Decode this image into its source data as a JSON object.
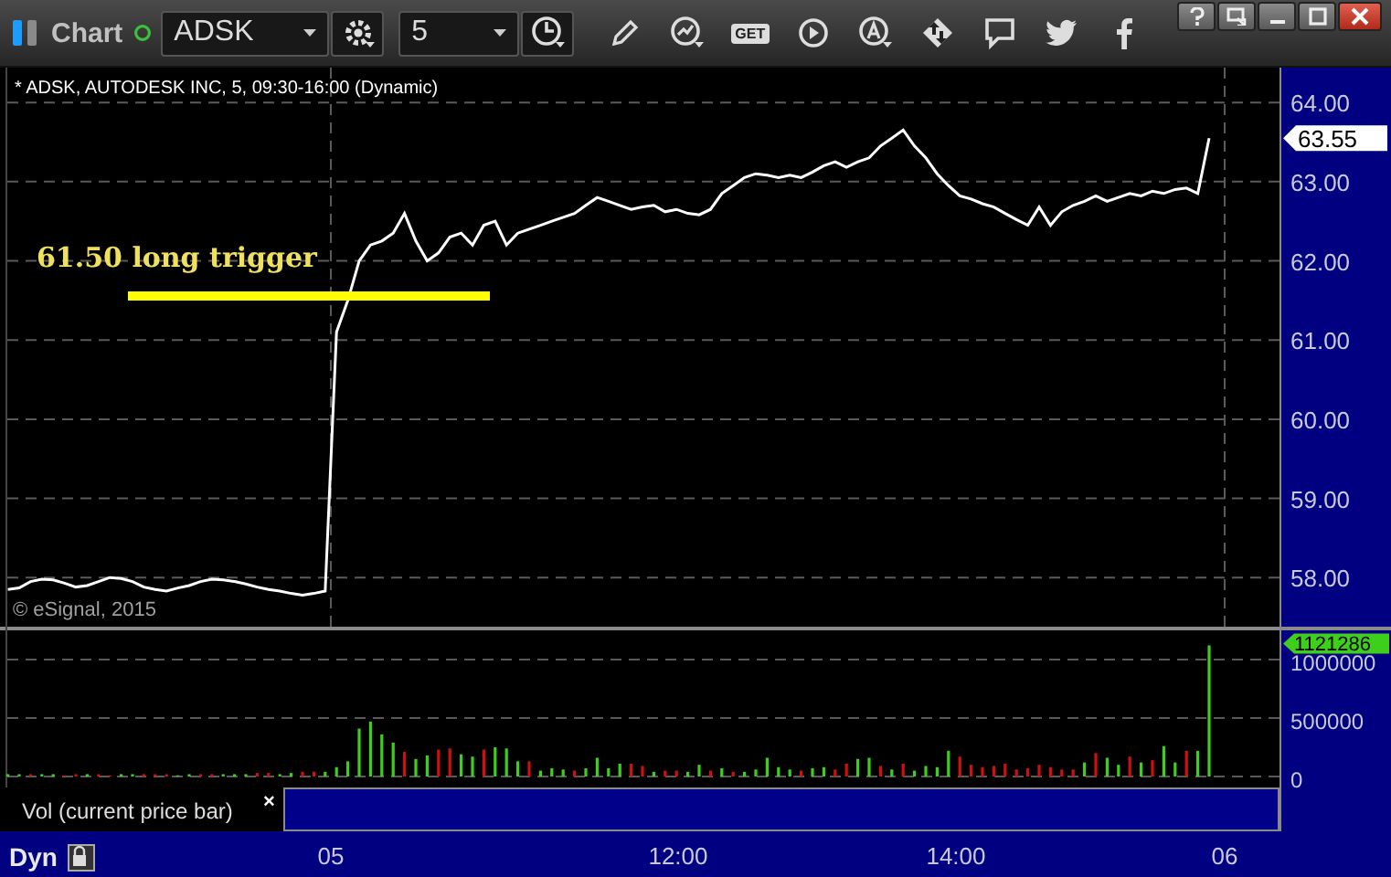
{
  "toolbar": {
    "title": "Chart",
    "symbol": "ADSK",
    "interval": "5",
    "get_label": "GET"
  },
  "price_panel": {
    "copyright": "© eSignal, 2015",
    "last_value_label": "63.55",
    "chart_data": {
      "type": "line",
      "title": "* ADSK, AUTODESK INC, 5, 09:30-16:00 (Dynamic)",
      "ylim": [
        57.38,
        64.44
      ],
      "grid": true,
      "yticks": [
        {
          "value": 58,
          "label": "58.00"
        },
        {
          "value": 59,
          "label": "59.00"
        },
        {
          "value": 60,
          "label": "60.00"
        },
        {
          "value": 61,
          "label": "61.00"
        },
        {
          "value": 62,
          "label": "62.00"
        },
        {
          "value": 63,
          "label": "63.00"
        },
        {
          "value": 64,
          "label": "64.00"
        }
      ],
      "series": [
        {
          "color": "#ffffff",
          "values": [
            57.85,
            57.87,
            57.95,
            57.98,
            57.97,
            57.93,
            57.88,
            57.9,
            57.95,
            58.0,
            57.99,
            57.95,
            57.88,
            57.85,
            57.83,
            57.87,
            57.9,
            57.95,
            57.98,
            57.97,
            57.95,
            57.92,
            57.88,
            57.85,
            57.83,
            57.8,
            57.78,
            57.8,
            57.83,
            61.1,
            61.5,
            62.0,
            62.2,
            62.25,
            62.35,
            62.6,
            62.25,
            62.0,
            62.1,
            62.3,
            62.35,
            62.2,
            62.45,
            62.5,
            62.2,
            62.35,
            62.4,
            62.45,
            62.5,
            62.55,
            62.6,
            62.7,
            62.8,
            62.75,
            62.7,
            62.65,
            62.68,
            62.7,
            62.62,
            62.65,
            62.6,
            62.58,
            62.65,
            62.85,
            62.95,
            63.05,
            63.1,
            63.08,
            63.05,
            63.08,
            63.05,
            63.12,
            63.2,
            63.25,
            63.18,
            63.25,
            63.3,
            63.45,
            63.55,
            63.65,
            63.45,
            63.3,
            63.1,
            62.95,
            62.82,
            62.78,
            62.72,
            62.68,
            62.6,
            62.52,
            62.45,
            62.68,
            62.45,
            62.62,
            62.7,
            62.75,
            62.82,
            62.75,
            62.8,
            62.85,
            62.82,
            62.88,
            62.85,
            62.9,
            62.92,
            62.85,
            63.55
          ]
        }
      ],
      "annotations": [
        "61.50 long trigger"
      ]
    }
  },
  "volume_panel": {
    "legend": "Vol (current price bar)",
    "legend_close": "×",
    "last_value_label": "1121286",
    "chart_data": {
      "type": "bar",
      "ylim": [
        0,
        1250000
      ],
      "grid": true,
      "yticks": [
        {
          "value": 0,
          "label": "0"
        },
        {
          "value": 500000,
          "label": "500000"
        },
        {
          "value": 1000000,
          "label": "1000000"
        }
      ],
      "series": [
        {
          "color": "#3ecf1c",
          "values": [
            20000,
            20000,
            null,
            20000,
            20000,
            null,
            null,
            20000,
            null,
            null,
            20000,
            20000,
            null,
            null,
            null,
            10000,
            20000,
            null,
            null,
            20000,
            20000,
            20000,
            null,
            null,
            20000,
            30000,
            null,
            null,
            40000,
            80000,
            130000,
            410000,
            470000,
            360000,
            290000,
            null,
            150000,
            180000,
            null,
            null,
            190000,
            170000,
            null,
            250000,
            240000,
            130000,
            null,
            50000,
            70000,
            60000,
            null,
            70000,
            160000,
            70000,
            110000,
            null,
            null,
            40000,
            null,
            null,
            40000,
            100000,
            null,
            70000,
            null,
            40000,
            60000,
            160000,
            80000,
            60000,
            null,
            70000,
            80000,
            null,
            null,
            150000,
            160000,
            null,
            60000,
            null,
            50000,
            90000,
            80000,
            220000,
            null,
            null,
            null,
            null,
            null,
            null,
            null,
            null,
            null,
            null,
            null,
            120000,
            null,
            160000,
            100000,
            null,
            120000,
            null,
            260000,
            120000,
            null,
            220000,
            1121286
          ]
        },
        {
          "color": "#d01010",
          "values": [
            null,
            null,
            20000,
            null,
            null,
            10000,
            20000,
            null,
            20000,
            10000,
            null,
            null,
            20000,
            20000,
            20000,
            null,
            null,
            20000,
            20000,
            null,
            null,
            null,
            30000,
            30000,
            null,
            null,
            40000,
            40000,
            null,
            null,
            null,
            null,
            null,
            null,
            null,
            210000,
            null,
            null,
            230000,
            240000,
            null,
            null,
            230000,
            null,
            null,
            null,
            130000,
            null,
            null,
            null,
            50000,
            null,
            null,
            null,
            null,
            110000,
            90000,
            null,
            50000,
            50000,
            null,
            null,
            50000,
            null,
            40000,
            null,
            null,
            null,
            null,
            null,
            50000,
            null,
            null,
            60000,
            110000,
            null,
            null,
            90000,
            null,
            110000,
            null,
            null,
            null,
            null,
            170000,
            100000,
            80000,
            90000,
            110000,
            60000,
            70000,
            100000,
            80000,
            60000,
            60000,
            null,
            200000,
            null,
            null,
            170000,
            null,
            140000,
            null,
            null,
            220000,
            null,
            null
          ]
        }
      ]
    }
  },
  "time_axis": {
    "mode": "Dyn",
    "labels": [
      "05",
      "12:00",
      "14:00",
      "06"
    ]
  }
}
